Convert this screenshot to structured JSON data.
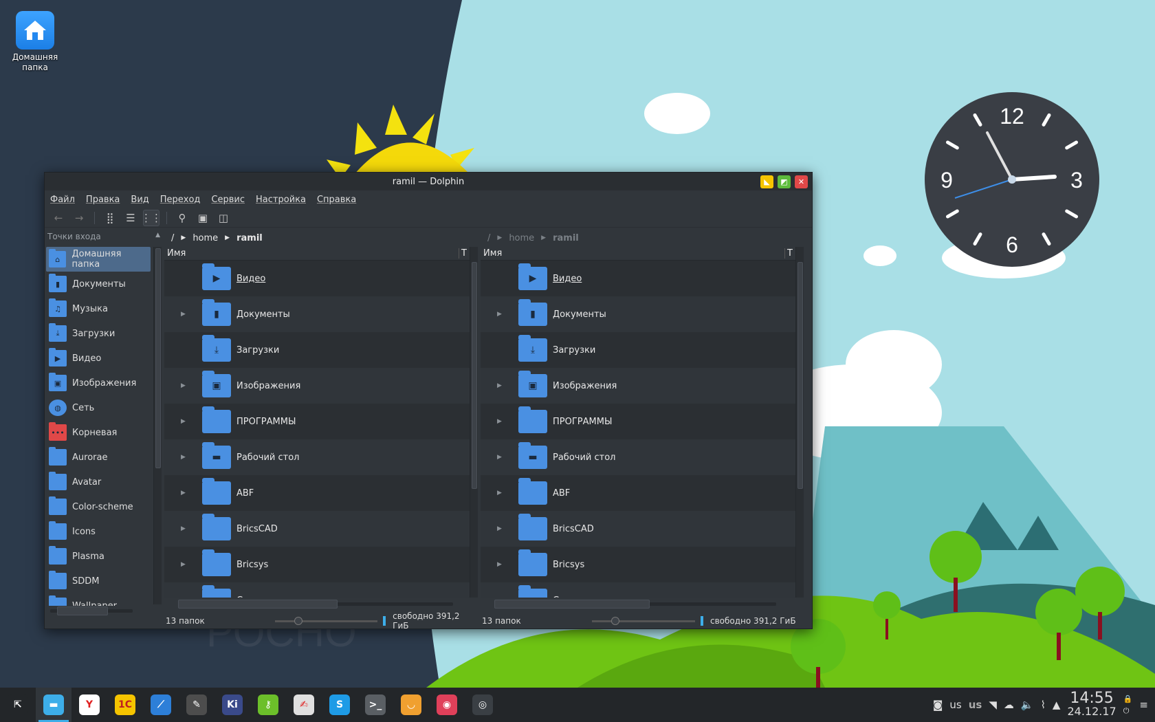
{
  "desktop": {
    "home_icon_label": "Домашняя папка"
  },
  "window": {
    "title": "ramil — Dolphin",
    "menu": [
      "Файл",
      "Правка",
      "Вид",
      "Переход",
      "Сервис",
      "Настройка",
      "Справка"
    ],
    "toolbar_icons": [
      "back-arrow-icon",
      "forward-arrow-icon",
      "icons-view-icon",
      "compact-view-icon",
      "details-view-icon",
      "search-icon",
      "preview-icon",
      "split-view-icon"
    ]
  },
  "sidebar": {
    "header": "Точки входа",
    "items": [
      {
        "label": "Домашняя папка",
        "icon": "home-icon",
        "glyph": "⌂"
      },
      {
        "label": "Документы",
        "icon": "documents-icon",
        "glyph": "▮"
      },
      {
        "label": "Музыка",
        "icon": "music-icon",
        "glyph": "♫"
      },
      {
        "label": "Загрузки",
        "icon": "downloads-icon",
        "glyph": "⤓"
      },
      {
        "label": "Видео",
        "icon": "video-icon",
        "glyph": "▶"
      },
      {
        "label": "Изображения",
        "icon": "pictures-icon",
        "glyph": "▣"
      },
      {
        "label": "Сеть",
        "icon": "network-icon",
        "glyph": "◍"
      },
      {
        "label": "Корневая",
        "icon": "root-folder-icon",
        "glyph": "•••"
      },
      {
        "label": "Aurorae",
        "icon": "folder-icon",
        "glyph": ""
      },
      {
        "label": "Avatar",
        "icon": "folder-icon",
        "glyph": ""
      },
      {
        "label": "Color-scheme",
        "icon": "folder-icon",
        "glyph": ""
      },
      {
        "label": "Icons",
        "icon": "folder-icon",
        "glyph": ""
      },
      {
        "label": "Plasma",
        "icon": "folder-icon",
        "glyph": ""
      },
      {
        "label": "SDDM",
        "icon": "folder-icon",
        "glyph": ""
      },
      {
        "label": "Wallpaper",
        "icon": "folder-icon",
        "glyph": ""
      }
    ]
  },
  "left_pane": {
    "breadcrumb": {
      "root": "/",
      "home": "home",
      "user": "ramil"
    },
    "column_name": "Имя",
    "column_type": "Т",
    "status_count": "13 папок",
    "free_space": "свободно 391,2 ГиБ"
  },
  "right_pane": {
    "breadcrumb": {
      "root": "/",
      "home": "home",
      "user": "ramil"
    },
    "column_name": "Имя",
    "column_type": "Т",
    "status_count": "13 папок",
    "free_space": "свободно 391,2 ГиБ"
  },
  "files": [
    {
      "name": "Видео",
      "glyph": "▶",
      "expandable": false
    },
    {
      "name": "Документы",
      "glyph": "▮",
      "expandable": true
    },
    {
      "name": "Загрузки",
      "glyph": "⤓",
      "expandable": false
    },
    {
      "name": "Изображения",
      "glyph": "▣",
      "expandable": true
    },
    {
      "name": "ПРОГРАММЫ",
      "glyph": "",
      "expandable": true
    },
    {
      "name": "Рабочий стол",
      "glyph": "▬",
      "expandable": true
    },
    {
      "name": "ABF",
      "glyph": "",
      "expandable": true
    },
    {
      "name": "BricsCAD",
      "glyph": "",
      "expandable": true
    },
    {
      "name": "Bricsys",
      "glyph": "",
      "expandable": true
    },
    {
      "name": "Cups",
      "glyph": "",
      "expandable": true
    }
  ],
  "clock_widget": {
    "numerals": {
      "n12": "12",
      "n3": "3",
      "n6": "6",
      "n9": "9"
    }
  },
  "taskbar": {
    "apps": [
      {
        "name": "launcher",
        "label": "⇱",
        "color": "#232629"
      },
      {
        "name": "dolphin",
        "label": "▬",
        "color": "#3daee9"
      },
      {
        "name": "yandex-browser",
        "label": "Y",
        "color": "#ffffff"
      },
      {
        "name": "1c",
        "label": "1С",
        "color": "#f5c400"
      },
      {
        "name": "bricscad",
        "label": "⟋",
        "color": "#2d7fd8"
      },
      {
        "name": "inkscape",
        "label": "✎",
        "color": "#4d4d4d"
      },
      {
        "name": "krita",
        "label": "Ki",
        "color": "#3a4a8a"
      },
      {
        "name": "keepass",
        "label": "⚷",
        "color": "#6cbf2a"
      },
      {
        "name": "notes",
        "label": "✍",
        "color": "#e0e0e0"
      },
      {
        "name": "skype",
        "label": "S",
        "color": "#1e9be6"
      },
      {
        "name": "terminal",
        "label": ">_",
        "color": "#5a5f64"
      },
      {
        "name": "package-manager",
        "label": "◡",
        "color": "#f0a030"
      },
      {
        "name": "design-app",
        "label": "◉",
        "color": "#e0405a"
      },
      {
        "name": "screenshot",
        "label": "◎",
        "color": "#3a3f44"
      }
    ],
    "tray": {
      "keyboard_layout": "us",
      "keyboard_layout_alt": "us",
      "time": "14:55",
      "date": "24.12.17"
    }
  },
  "colors": {
    "accent": "#3daee9",
    "folder": "#4a90e2",
    "window_bg": "#31363b",
    "minimize": "#f5c400",
    "maximize": "#5dbb3c",
    "close": "#e04848"
  }
}
